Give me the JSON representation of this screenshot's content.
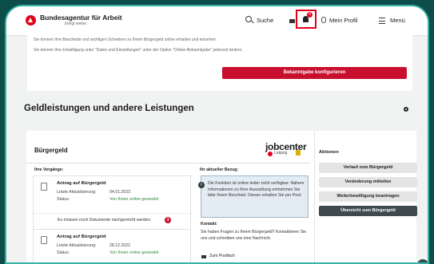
{
  "header": {
    "brand": "Bundesagentur für Arbeit",
    "brand_sub": "bringt weiter.",
    "search": "Suche",
    "notification_count": "9",
    "profile": "Mein Profil",
    "menu": "Menü"
  },
  "notice": {
    "line1": "Sie können Ihre Bescheide und wichtigen Schreiben zu Ihrem Bürgergeld online erhalten und einsehen.",
    "line2": "Sie können Ihre Einwilligung unter \"Daten und Einstellungen\" unter der Option \"Online-Bekanntgabe\" jederzeit ändern.",
    "button": "Bekanntgabe konfigurieren"
  },
  "section": {
    "title": "Geldleistungen und andere Leistungen"
  },
  "buergergeld": {
    "title": "Bürgergeld",
    "jobcenter_brand": "jobcenter",
    "jobcenter_city": "Leipzig",
    "vorgaenge_label": "Ihre Vorgänge:",
    "bezug_label": "Ihr aktueller Bezug:",
    "items": [
      {
        "title": "Antrag auf Bürgergeld",
        "updated_label": "Letzte Aktualisierung:",
        "updated": "04.01.2023",
        "status_label": "Status:",
        "status": "Von Ihnen online gesendet"
      },
      {
        "title": "Antrag auf Bürgergeld",
        "updated_label": "Letzte Aktualisierung:",
        "updated": "28.12.2022",
        "status_label": "Status:",
        "status": "Von Ihnen online gesendet"
      }
    ],
    "missing_docs": "Es müssen noch Dokumente nachgereicht werden.",
    "missing_count": "3",
    "info_text": "Die Funktion ist online leider nicht verfügbar. Nähere Informationen zu Ihrer Auszahlung entnehmen Sie bitte Ihrem Bescheid. Diesen erhalten Sie per Post.",
    "kontakt_label": "Kontakt:",
    "kontakt_text": "Sie haben Fragen zu Ihrem Bürgergeld? Kontaktieren Sie uns und schreiben uns eine Nachricht.",
    "postfach": "Zum Postfach"
  },
  "aktionen": {
    "label": "Aktionen",
    "buttons": [
      "Verlauf zum Bürgergeld",
      "Veränderung mitteilen",
      "Weiterbewilligung beantragen",
      "Übersicht zum Bürgergeld"
    ]
  }
}
